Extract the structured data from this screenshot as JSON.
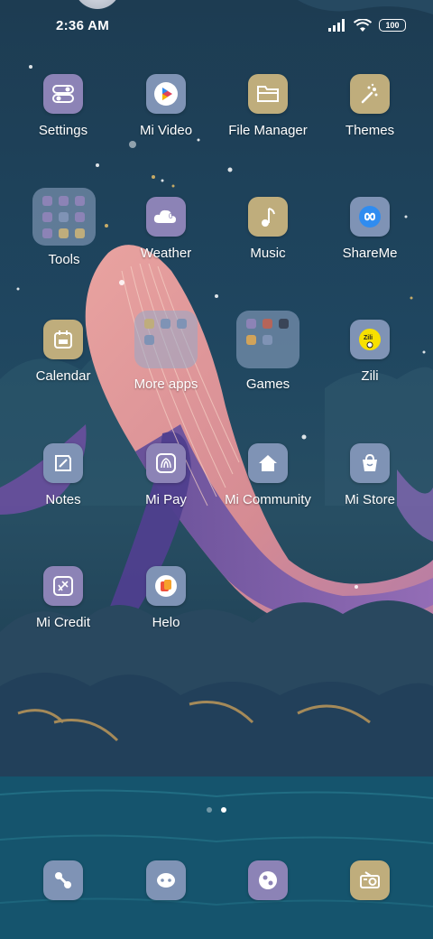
{
  "status_bar": {
    "time": "2:36 AM",
    "battery": "100",
    "icons": [
      "signal-icon",
      "wifi-icon",
      "battery-icon"
    ]
  },
  "home": {
    "apps": [
      {
        "label": "Settings",
        "icon": "settings-icon",
        "color": "#8c83b6"
      },
      {
        "label": "Mi Video",
        "icon": "play-icon",
        "color": "#7f93b5"
      },
      {
        "label": "File Manager",
        "icon": "folder-icon",
        "color": "#bfad7c"
      },
      {
        "label": "Themes",
        "icon": "brush-icon",
        "color": "#bfad7c"
      },
      {
        "label": "Tools",
        "icon": "tools-folder",
        "color": "#7f93b5"
      },
      {
        "label": "Weather",
        "icon": "cloud-icon",
        "color": "#8c83b6",
        "badge": "0°"
      },
      {
        "label": "Music",
        "icon": "music-note-icon",
        "color": "#bfad7c"
      },
      {
        "label": "ShareMe",
        "icon": "infinity-icon",
        "color": "#7f93b5"
      },
      {
        "label": "Calendar",
        "icon": "calendar-icon",
        "color": "#bfad7c"
      },
      {
        "label": "More apps",
        "icon": "more-apps-folder",
        "color": "#7f93b5"
      },
      {
        "label": "Games",
        "icon": "games-folder",
        "color": "#7f93b5"
      },
      {
        "label": "Zili",
        "icon": "zili-icon",
        "color": "#7f93b5",
        "badge": "Zili"
      },
      {
        "label": "Notes",
        "icon": "notes-icon",
        "color": "#7f93b5"
      },
      {
        "label": "Mi Pay",
        "icon": "mi-pay-icon",
        "color": "#8c83b6"
      },
      {
        "label": "Mi Community",
        "icon": "home-icon",
        "color": "#7f93b5"
      },
      {
        "label": "Mi Store",
        "icon": "shopping-bag-icon",
        "color": "#7f93b5"
      },
      {
        "label": "Mi Credit",
        "icon": "mi-credit-icon",
        "color": "#8c83b6"
      },
      {
        "label": "Helo",
        "icon": "helo-icon",
        "color": "#7f93b5"
      }
    ],
    "page_count": 2,
    "active_page": 2
  },
  "dock": [
    {
      "icon": "phone-icon",
      "color": "#7f93b5"
    },
    {
      "icon": "messages-icon",
      "color": "#7f93b5"
    },
    {
      "icon": "browser-icon",
      "color": "#8c83b6"
    },
    {
      "icon": "camera-icon",
      "color": "#bfad7c"
    }
  ]
}
